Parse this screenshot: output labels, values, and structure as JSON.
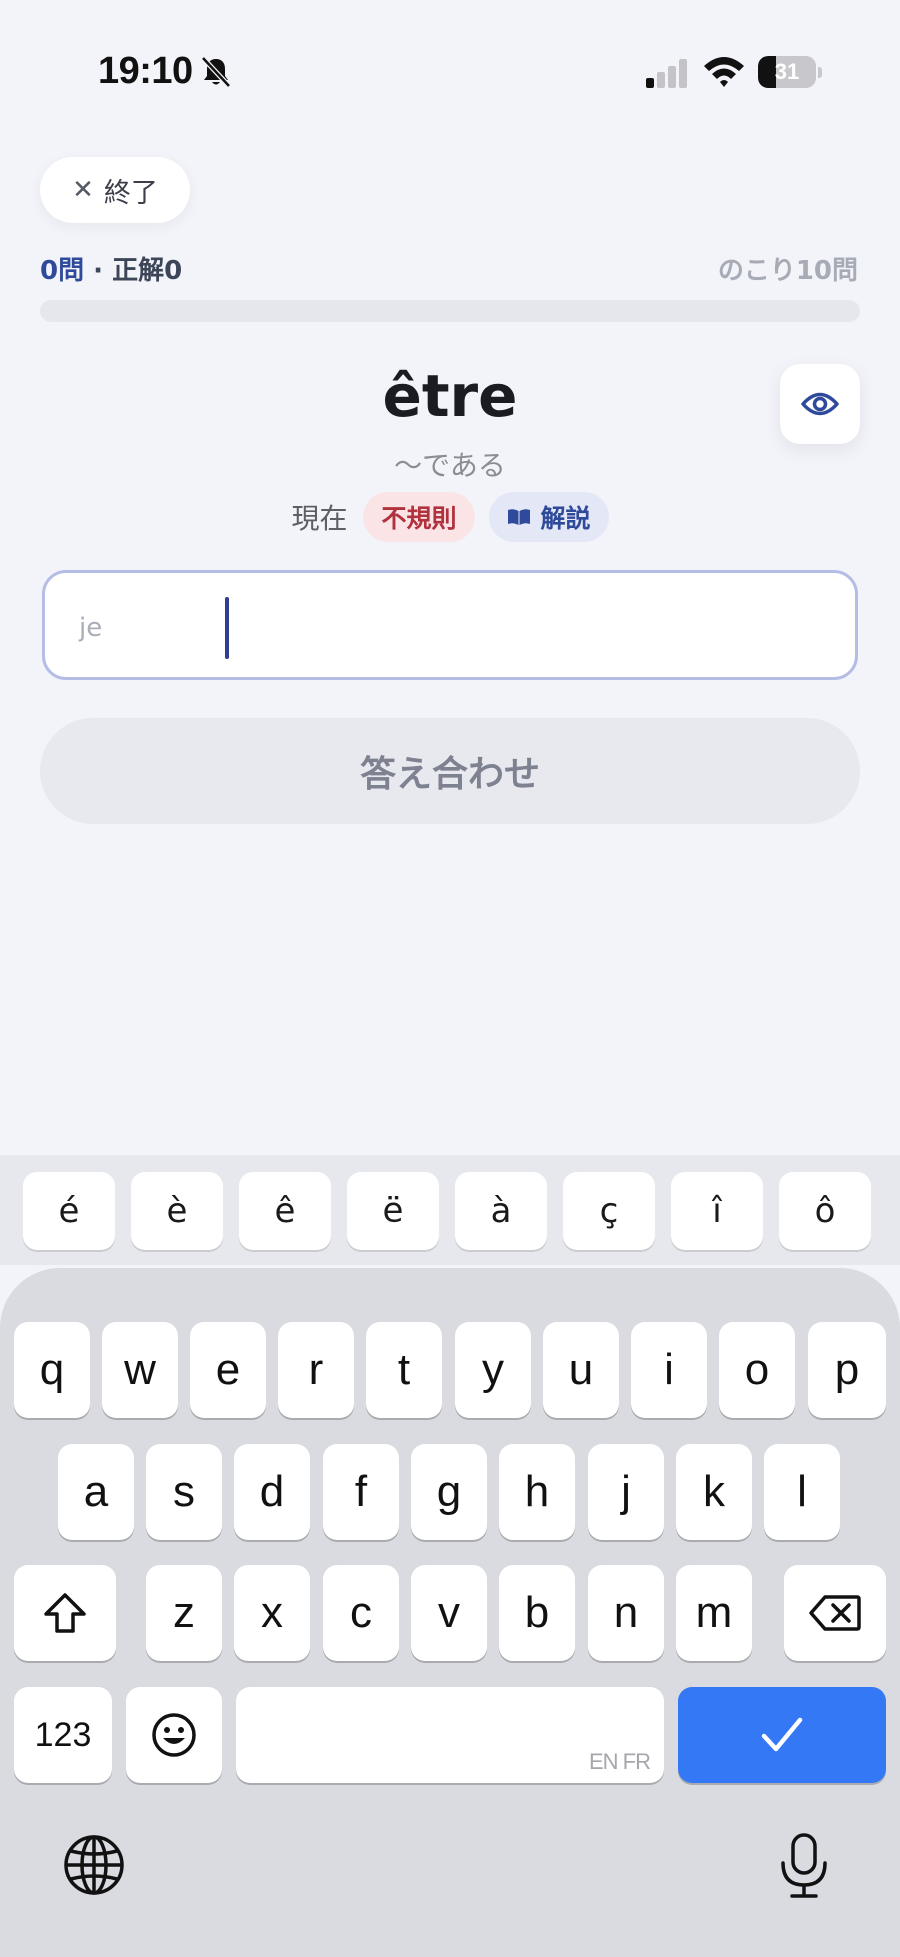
{
  "status_bar": {
    "time": "19:10",
    "battery_level": "31",
    "battery_fraction": 0.31
  },
  "header": {
    "close_label": "終了",
    "progress": {
      "answered": "0問",
      "separator": " · ",
      "correct": "正解0",
      "remaining": "のこり10問",
      "fraction": 0
    }
  },
  "question": {
    "verb": "être",
    "meaning": "〜である",
    "tense": "現在",
    "irregular_tag": "不規則",
    "explain_tag": "解説",
    "pronoun_placeholder": "je",
    "answer_value": ""
  },
  "check_button": "答え合わせ",
  "accent_keys": [
    "é",
    "è",
    "ê",
    "ë",
    "à",
    "ç",
    "î",
    "ô"
  ],
  "keyboard": {
    "row1": [
      "q",
      "w",
      "e",
      "r",
      "t",
      "y",
      "u",
      "i",
      "o",
      "p"
    ],
    "row2": [
      "a",
      "s",
      "d",
      "f",
      "g",
      "h",
      "j",
      "k",
      "l"
    ],
    "row3": [
      "z",
      "x",
      "c",
      "v",
      "b",
      "n",
      "m"
    ],
    "numbers_key": "123",
    "space_languages": "EN FR",
    "icons": [
      "shift-icon",
      "backspace-icon",
      "emoji-icon",
      "checkmark-icon",
      "globe-icon",
      "microphone-icon"
    ]
  },
  "colors": {
    "accent": "#2f4a9a",
    "done_key": "#3478f6",
    "irregular": "#b0323d"
  }
}
